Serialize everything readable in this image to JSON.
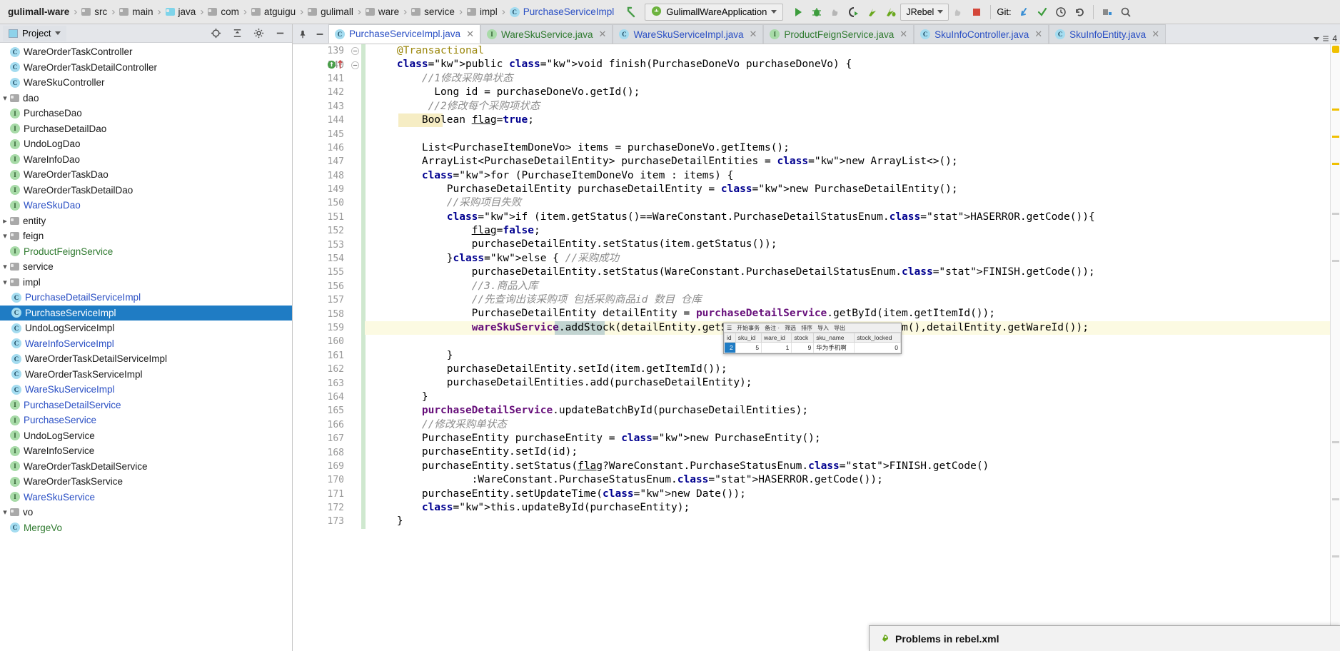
{
  "breadcrumb": {
    "items": [
      {
        "label": "gulimall-ware",
        "icon": "none",
        "style": "bold"
      },
      {
        "label": "src",
        "icon": "folder",
        "style": "plain"
      },
      {
        "label": "main",
        "icon": "folder",
        "style": "plain"
      },
      {
        "label": "java",
        "icon": "folder-blue",
        "style": "plain"
      },
      {
        "label": "com",
        "icon": "folder",
        "style": "plain"
      },
      {
        "label": "atguigu",
        "icon": "folder",
        "style": "plain"
      },
      {
        "label": "gulimall",
        "icon": "folder",
        "style": "plain"
      },
      {
        "label": "ware",
        "icon": "folder",
        "style": "plain"
      },
      {
        "label": "service",
        "icon": "folder",
        "style": "plain"
      },
      {
        "label": "impl",
        "icon": "folder",
        "style": "plain"
      },
      {
        "label": "PurchaseServiceImpl",
        "icon": "class",
        "style": "blue"
      }
    ],
    "separator": "›"
  },
  "toolbar": {
    "back_arrow_icon": "navigate-back-icon",
    "run_config_name": "GulimallWareApplication",
    "run_config_icon": "spring-boot-icon",
    "buttons": [
      {
        "name": "run-button",
        "glyph": "▶",
        "color": "#3c9c3c"
      },
      {
        "name": "debug-button",
        "glyph": "bug",
        "color": "#3c9c3c"
      },
      {
        "name": "run-with-coverage-button",
        "glyph": "coverage",
        "color": "#9a9a9a"
      },
      {
        "name": "profile-button",
        "glyph": "profile",
        "color": "#3a3a3a"
      },
      {
        "name": "jrebel-run-button",
        "glyph": "jrebel-run",
        "color": "#6aa81e"
      },
      {
        "name": "jrebel-debug-button",
        "glyph": "jrebel-debug",
        "color": "#6aa81e"
      }
    ],
    "jrebel_label": "JRebel",
    "after_jrebel": [
      {
        "name": "attach-profiler-button",
        "color": "#b0b0b0"
      },
      {
        "name": "stop-button",
        "color": "#d4473a"
      }
    ],
    "git_label": "Git:",
    "git_buttons": [
      {
        "name": "git-update-project-button",
        "glyph": "↙",
        "color": "#3a8fd4"
      },
      {
        "name": "git-commit-button",
        "glyph": "✓",
        "color": "#3c9c3c"
      },
      {
        "name": "git-history-button",
        "glyph": "◴",
        "color": "#4a4a4a"
      },
      {
        "name": "git-rollback-button",
        "glyph": "↺",
        "color": "#4a4a4a"
      }
    ],
    "trailing_buttons": [
      {
        "name": "project-structure-button"
      },
      {
        "name": "search-everywhere-button"
      }
    ]
  },
  "project_panel": {
    "title": "Project",
    "view_icon": "project-view-icon",
    "dropdown_icon": "chevron-down-icon",
    "header_buttons": [
      {
        "name": "scroll-from-source-button",
        "glyph": "target-icon"
      },
      {
        "name": "collapse-all-button",
        "glyph": "collapse-icon"
      },
      {
        "name": "settings-gear-button",
        "glyph": "gear-icon"
      },
      {
        "name": "hide-panel-button",
        "glyph": "minimize-icon"
      }
    ],
    "tree": [
      {
        "label": "WareOrderTaskController",
        "type": "class",
        "indent": 5,
        "arrow": "",
        "color": "dark"
      },
      {
        "label": "WareOrderTaskDetailController",
        "type": "class",
        "indent": 5,
        "arrow": "",
        "color": "dark"
      },
      {
        "label": "WareSkuController",
        "type": "class",
        "indent": 5,
        "arrow": "",
        "color": "dark"
      },
      {
        "label": "dao",
        "type": "folder",
        "indent": 3,
        "arrow": "⌄",
        "color": "dark"
      },
      {
        "label": "PurchaseDao",
        "type": "iface",
        "indent": 5,
        "arrow": "",
        "color": "dark"
      },
      {
        "label": "PurchaseDetailDao",
        "type": "iface",
        "indent": 5,
        "arrow": "",
        "color": "dark"
      },
      {
        "label": "UndoLogDao",
        "type": "iface",
        "indent": 5,
        "arrow": "",
        "color": "dark"
      },
      {
        "label": "WareInfoDao",
        "type": "iface",
        "indent": 5,
        "arrow": "",
        "color": "dark"
      },
      {
        "label": "WareOrderTaskDao",
        "type": "iface",
        "indent": 5,
        "arrow": "",
        "color": "dark"
      },
      {
        "label": "WareOrderTaskDetailDao",
        "type": "iface",
        "indent": 5,
        "arrow": "",
        "color": "dark"
      },
      {
        "label": "WareSkuDao",
        "type": "iface",
        "indent": 5,
        "arrow": "",
        "color": "blue"
      },
      {
        "label": "entity",
        "type": "folder",
        "indent": 3,
        "arrow": "›",
        "color": "dark"
      },
      {
        "label": "feign",
        "type": "folder",
        "indent": 3,
        "arrow": "⌄",
        "color": "dark"
      },
      {
        "label": "ProductFeignService",
        "type": "iface",
        "indent": 5,
        "arrow": "",
        "color": "green"
      },
      {
        "label": "service",
        "type": "folder",
        "indent": 3,
        "arrow": "⌄",
        "color": "dark"
      },
      {
        "label": "impl",
        "type": "folder",
        "indent": 4,
        "arrow": "⌄",
        "color": "dark"
      },
      {
        "label": "PurchaseDetailServiceImpl",
        "type": "class",
        "indent": 6,
        "arrow": "",
        "color": "blue"
      },
      {
        "label": "PurchaseServiceImpl",
        "type": "class",
        "indent": 6,
        "arrow": "",
        "color": "blue",
        "selected": true
      },
      {
        "label": "UndoLogServiceImpl",
        "type": "class",
        "indent": 6,
        "arrow": "",
        "color": "dark"
      },
      {
        "label": "WareInfoServiceImpl",
        "type": "class",
        "indent": 6,
        "arrow": "",
        "color": "blue"
      },
      {
        "label": "WareOrderTaskDetailServiceImpl",
        "type": "class",
        "indent": 6,
        "arrow": "",
        "color": "dark"
      },
      {
        "label": "WareOrderTaskServiceImpl",
        "type": "class",
        "indent": 6,
        "arrow": "",
        "color": "dark"
      },
      {
        "label": "WareSkuServiceImpl",
        "type": "class",
        "indent": 6,
        "arrow": "",
        "color": "blue"
      },
      {
        "label": "PurchaseDetailService",
        "type": "iface",
        "indent": 5,
        "arrow": "",
        "color": "blue"
      },
      {
        "label": "PurchaseService",
        "type": "iface",
        "indent": 5,
        "arrow": "",
        "color": "blue"
      },
      {
        "label": "UndoLogService",
        "type": "iface",
        "indent": 5,
        "arrow": "",
        "color": "dark"
      },
      {
        "label": "WareInfoService",
        "type": "iface",
        "indent": 5,
        "arrow": "",
        "color": "dark"
      },
      {
        "label": "WareOrderTaskDetailService",
        "type": "iface",
        "indent": 5,
        "arrow": "",
        "color": "dark"
      },
      {
        "label": "WareOrderTaskService",
        "type": "iface",
        "indent": 5,
        "arrow": "",
        "color": "dark"
      },
      {
        "label": "WareSkuService",
        "type": "iface",
        "indent": 5,
        "arrow": "",
        "color": "blue"
      },
      {
        "label": "vo",
        "type": "folder",
        "indent": 3,
        "arrow": "⌄",
        "color": "dark"
      },
      {
        "label": "MergeVo",
        "type": "class",
        "indent": 5,
        "arrow": "",
        "color": "green"
      }
    ]
  },
  "editor_tabs": {
    "tools": [
      {
        "name": "pin-tab-button",
        "glyph": "⚒"
      },
      {
        "name": "hide-tabs-button",
        "glyph": "—"
      }
    ],
    "tabs": [
      {
        "label": "PurchaseServiceImpl.java",
        "icon": "class",
        "active": true,
        "color": "blue"
      },
      {
        "label": "WareSkuService.java",
        "icon": "iface",
        "active": false,
        "color": "green"
      },
      {
        "label": "WareSkuServiceImpl.java",
        "icon": "class",
        "active": false,
        "color": "blue"
      },
      {
        "label": "ProductFeignService.java",
        "icon": "iface",
        "active": false,
        "color": "green"
      },
      {
        "label": "SkuInfoController.java",
        "icon": "class",
        "active": false,
        "color": "blue"
      },
      {
        "label": "SkuInfoEntity.java",
        "icon": "class",
        "active": false,
        "color": "blue"
      }
    ],
    "overflow_count": "4",
    "close_glyph": "✕"
  },
  "code": {
    "first_line": 139,
    "gutter_markers": [
      {
        "line": 140,
        "name": "implemented-method-marker",
        "glyph": "①"
      },
      {
        "line": 140,
        "name": "override-arrow-marker",
        "glyph": "↑"
      }
    ],
    "fold_markers": [
      {
        "line": 139,
        "glyph": "−"
      },
      {
        "line": 140,
        "glyph": "−"
      }
    ],
    "highlight_line": 159,
    "lines": [
      {
        "n": 139,
        "text": "    @Transactional"
      },
      {
        "n": 140,
        "text": "    public void finish(PurchaseDoneVo purchaseDoneVo) {"
      },
      {
        "n": 141,
        "text": "        //1修改采购单状态"
      },
      {
        "n": 142,
        "text": "          Long id = purchaseDoneVo.getId();"
      },
      {
        "n": 143,
        "text": "         //2修改每个采购项状态"
      },
      {
        "n": 144,
        "text": "        Boolean flag=true;"
      },
      {
        "n": 145,
        "text": ""
      },
      {
        "n": 146,
        "text": "        List<PurchaseItemDoneVo> items = purchaseDoneVo.getItems();"
      },
      {
        "n": 147,
        "text": "        ArrayList<PurchaseDetailEntity> purchaseDetailEntities = new ArrayList<>();"
      },
      {
        "n": 148,
        "text": "        for (PurchaseItemDoneVo item : items) {"
      },
      {
        "n": 149,
        "text": "            PurchaseDetailEntity purchaseDetailEntity = new PurchaseDetailEntity();"
      },
      {
        "n": 150,
        "text": "            //采购项目失败"
      },
      {
        "n": 151,
        "text": "            if (item.getStatus()==WareConstant.PurchaseDetailStatusEnum.HASERROR.getCode()){"
      },
      {
        "n": 152,
        "text": "                flag=false;"
      },
      {
        "n": 153,
        "text": "                purchaseDetailEntity.setStatus(item.getStatus());"
      },
      {
        "n": 154,
        "text": "            }else { //采购成功"
      },
      {
        "n": 155,
        "text": "                purchaseDetailEntity.setStatus(WareConstant.PurchaseDetailStatusEnum.FINISH.getCode());"
      },
      {
        "n": 156,
        "text": "                //3.商品入库"
      },
      {
        "n": 157,
        "text": "                //先查询出该采购项 包括采购商品id 数目 仓库"
      },
      {
        "n": 158,
        "text": "                PurchaseDetailEntity detailEntity = purchaseDetailService.getById(item.getItemId());"
      },
      {
        "n": 159,
        "text": "                wareSkuService.addStock(detailEntity.getSkuId(),detailEntity.getSkuNum(),detailEntity.getWareId());"
      },
      {
        "n": 160,
        "text": ""
      },
      {
        "n": 161,
        "text": "            }"
      },
      {
        "n": 162,
        "text": "            purchaseDetailEntity.setId(item.getItemId());"
      },
      {
        "n": 163,
        "text": "            purchaseDetailEntities.add(purchaseDetailEntity);"
      },
      {
        "n": 164,
        "text": "        }"
      },
      {
        "n": 165,
        "text": "        purchaseDetailService.updateBatchById(purchaseDetailEntities);"
      },
      {
        "n": 166,
        "text": "        //修改采购单状态"
      },
      {
        "n": 167,
        "text": "        PurchaseEntity purchaseEntity = new PurchaseEntity();"
      },
      {
        "n": 168,
        "text": "        purchaseEntity.setId(id);"
      },
      {
        "n": 169,
        "text": "        purchaseEntity.setStatus(flag?WareConstant.PurchaseStatusEnum.FINISH.getCode()"
      },
      {
        "n": 170,
        "text": "                :WareConstant.PurchaseStatusEnum.HASERROR.getCode());"
      },
      {
        "n": 171,
        "text": "        purchaseEntity.setUpdateTime(new Date());"
      },
      {
        "n": 172,
        "text": "        this.updateById(purchaseEntity);"
      },
      {
        "n": 173,
        "text": "    }"
      }
    ]
  },
  "db_popup": {
    "toolbar_items": [
      "☰",
      "开始事务",
      "备注 ·",
      "筛选",
      "排序",
      "导入",
      "导出"
    ],
    "columns": [
      "id",
      "sku_id",
      "ware_id",
      "stock",
      "sku_name",
      "stock_locked"
    ],
    "rows": [
      {
        "id": "2",
        "sku_id": "5",
        "ware_id": "1",
        "stock": "9",
        "sku_name": "华为手机啊",
        "stock_locked": "0"
      }
    ],
    "selected_cell": "id"
  },
  "rebel_popup": {
    "title": "Problems in rebel.xml",
    "icon": "jrebel-rocket-icon"
  },
  "colors": {
    "accent": "#1f7cc4",
    "keyword": "#00008f",
    "comment": "#8c8c8c",
    "annotation": "#9b870c",
    "static_field": "#660e7a",
    "link": "#2a4fc4",
    "green": "#2f7a2f",
    "highlight_line": "#fcfae2",
    "toolbar_bg": "#e8e8e8"
  }
}
